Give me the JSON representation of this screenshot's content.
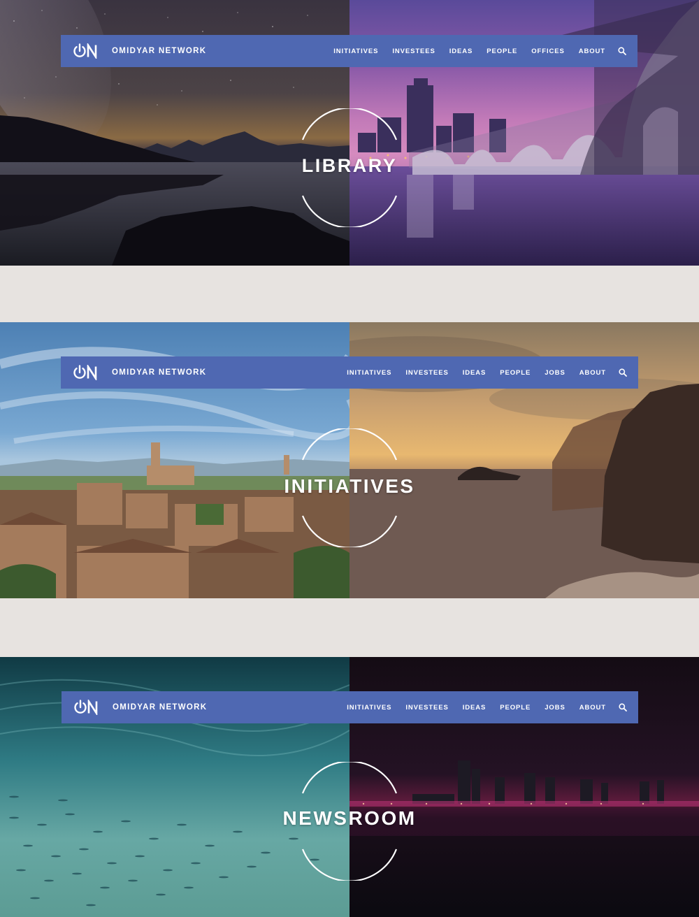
{
  "brand": {
    "name": "OMIDYAR NETWORK",
    "logo_text": "ON"
  },
  "heroes": [
    {
      "title": "LIBRARY",
      "nav": [
        "INITIATIVES",
        "INVESTEES",
        "IDEAS",
        "PEOPLE",
        "OFFICES",
        "ABOUT"
      ]
    },
    {
      "title": "INITIATIVES",
      "nav": [
        "INITIATIVES",
        "INVESTEES",
        "IDEAS",
        "PEOPLE",
        "JOBS",
        "ABOUT"
      ]
    },
    {
      "title": "NEWSROOM",
      "nav": [
        "INITIATIVES",
        "INVESTEES",
        "IDEAS",
        "PEOPLE",
        "JOBS",
        "ABOUT"
      ]
    }
  ],
  "colors": {
    "navbar": "#4f68b2",
    "page_background": "#e7e3e0",
    "text": "#ffffff"
  },
  "icons": {
    "logo": "power-logo-icon",
    "search": "search-icon"
  }
}
